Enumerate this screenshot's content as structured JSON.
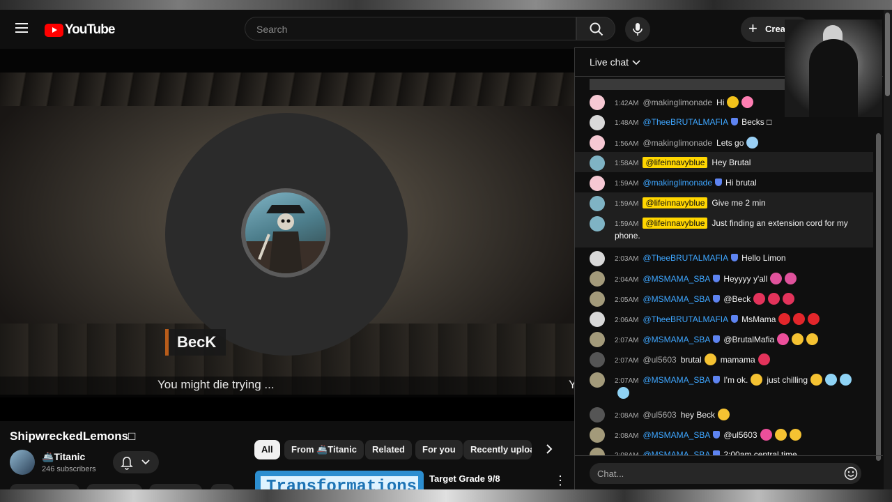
{
  "header": {
    "logo_text": "YouTube",
    "search_placeholder": "Search",
    "create_label": "Creat"
  },
  "player": {
    "name_tag": "BecK",
    "caption": "You might die trying ...",
    "caption_cut": "Y"
  },
  "video": {
    "title": "ShipwreckedLemons□",
    "channel_name": "🚢Titanic",
    "subscribers": "246 subscribers"
  },
  "chips": [
    {
      "label": "All",
      "active": true
    },
    {
      "label": "From 🚢Titanic",
      "active": false
    },
    {
      "label": "Related",
      "active": false
    },
    {
      "label": "For you",
      "active": false
    },
    {
      "label": "Recently uploa",
      "active": false
    }
  ],
  "recommendation": {
    "thumb_text": "Transformations",
    "title": "Target Grade 9/8"
  },
  "chat": {
    "title": "Live chat",
    "input_placeholder": "Chat...",
    "messages": [
      {
        "time": "1:42AM",
        "author": "@makinglimonade",
        "role": "plain",
        "text": "Hi",
        "emojis": [
          "#f2c21b",
          "#ff7eb3"
        ],
        "avatar": "#f6c8d3"
      },
      {
        "time": "1:48AM",
        "author": "@TheeBRUTALMAFIA",
        "role": "mod",
        "text": "Becks □",
        "emojis": [],
        "avatar": "#d8d8d8"
      },
      {
        "time": "1:56AM",
        "author": "@makinglimonade",
        "role": "plain",
        "text": "Lets go",
        "emojis": [
          "#9ad0f5"
        ],
        "avatar": "#f6c8d3"
      },
      {
        "time": "1:58AM",
        "author": "@lifeinnavyblue",
        "role": "owner",
        "text": "Hey Brutal",
        "emojis": [],
        "avatar": "#7fb3c4",
        "highlight": true
      },
      {
        "time": "1:59AM",
        "author": "@makinglimonade",
        "role": "mod",
        "text": "Hi brutal",
        "emojis": [],
        "avatar": "#f6c8d3"
      },
      {
        "time": "1:59AM",
        "author": "@lifeinnavyblue",
        "role": "owner",
        "text": "Give me 2 min",
        "emojis": [],
        "avatar": "#7fb3c4",
        "highlight": true
      },
      {
        "time": "1:59AM",
        "author": "@lifeinnavyblue",
        "role": "owner",
        "text": "Just finding an extension cord for my phone.",
        "emojis": [],
        "avatar": "#7fb3c4",
        "highlight": true,
        "tall": true
      },
      {
        "time": "2:03AM",
        "author": "@TheeBRUTALMAFIA",
        "role": "mod",
        "text": "Hello Limon",
        "emojis": [],
        "avatar": "#d8d8d8"
      },
      {
        "time": "2:04AM",
        "author": "@MSMAMA_SBA",
        "role": "mod",
        "text": "Heyyyy y'all",
        "emojis": [
          "#e0529c",
          "#e0529c"
        ],
        "avatar": "#a39a7a"
      },
      {
        "time": "2:05AM",
        "author": "@MSMAMA_SBA",
        "role": "mod",
        "text": "@Beck",
        "emojis": [
          "#e3335b",
          "#e3335b",
          "#e3335b"
        ],
        "avatar": "#a39a7a"
      },
      {
        "time": "2:06AM",
        "author": "@TheeBRUTALMAFIA",
        "role": "mod",
        "text": "MsMama",
        "emojis": [
          "#e3262b",
          "#e3262b",
          "#e3262b"
        ],
        "avatar": "#d8d8d8"
      },
      {
        "time": "2:07AM",
        "author": "@MSMAMA_SBA",
        "role": "mod",
        "text": "@BrutalMafia",
        "emojis": [
          "#ec4f9b",
          "#f5c232",
          "#f5c232"
        ],
        "avatar": "#a39a7a"
      },
      {
        "time": "2:07AM",
        "author": "@ul5603",
        "role": "plain",
        "text": "brutal",
        "emojis": [
          "#f5c232"
        ],
        "text2": "mamama",
        "emojis2": [
          "#e3335b"
        ],
        "avatar": "#555555"
      },
      {
        "time": "2:07AM",
        "author": "@MSMAMA_SBA",
        "role": "mod",
        "text": "I'm ok.",
        "emojis": [
          "#f5c232"
        ],
        "text2": "just chilling",
        "emojis2": [
          "#f5c232",
          "#8fd3f5",
          "#8fd3f5",
          "#8fd3f5"
        ],
        "avatar": "#a39a7a",
        "tall": true
      },
      {
        "time": "2:08AM",
        "author": "@ul5603",
        "role": "plain",
        "text": "hey Beck",
        "emojis": [
          "#f5c232"
        ],
        "avatar": "#555555"
      },
      {
        "time": "2:08AM",
        "author": "@MSMAMA_SBA",
        "role": "mod",
        "text": "@ul5603",
        "emojis": [
          "#ec4f9b",
          "#f5c232",
          "#f5c232"
        ],
        "avatar": "#a39a7a"
      },
      {
        "time": "2:08AM",
        "author": "@MSMAMA_SBA",
        "role": "mod",
        "text": "2:00am central time",
        "emojis": [],
        "avatar": "#a39a7a"
      }
    ]
  },
  "colors": {
    "brand_red": "#ff0000",
    "owner_badge": "#ffd600",
    "mod_name": "#3ea6ff",
    "background": "#0f0f0f"
  }
}
